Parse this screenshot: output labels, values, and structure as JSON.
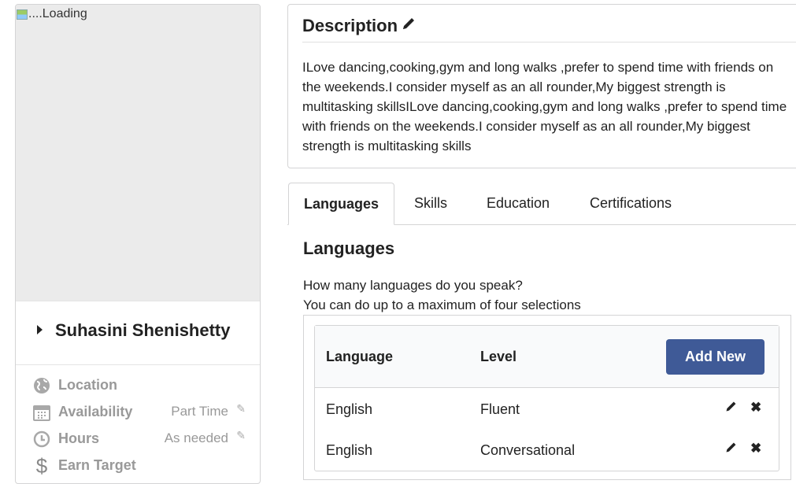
{
  "profile": {
    "photo_alt": "....Loading",
    "name": "Suhasini Shenishetty",
    "info": [
      {
        "icon": "globe-icon",
        "label": "Location",
        "value": ""
      },
      {
        "icon": "calendar-icon",
        "label": "Availability",
        "value": "Part Time"
      },
      {
        "icon": "clock-icon",
        "label": "Hours",
        "value": "As needed"
      },
      {
        "icon": "dollar-icon",
        "label": "Earn Target",
        "value": ""
      }
    ]
  },
  "description": {
    "title": "Description",
    "text": "ILove dancing,cooking,gym and long walks ,prefer to spend time with friends on the weekends.I consider myself as an all rounder,My biggest strength is multitasking skillsILove dancing,cooking,gym and long walks ,prefer to spend time with friends on the weekends.I consider myself as an all rounder,My biggest strength is multitasking skills"
  },
  "tabs": [
    {
      "label": "Languages",
      "active": true
    },
    {
      "label": "Skills",
      "active": false
    },
    {
      "label": "Education",
      "active": false
    },
    {
      "label": "Certifications",
      "active": false
    }
  ],
  "languages": {
    "heading": "Languages",
    "question": "How many languages do you speak?",
    "hint": "You can do up to a maximum of four selections",
    "columns": [
      "Language",
      "Level"
    ],
    "add_label": "Add New",
    "rows": [
      {
        "language": "English",
        "level": "Fluent"
      },
      {
        "language": "English",
        "level": "Conversational"
      }
    ]
  },
  "colors": {
    "accent": "#3f5a97",
    "border": "#d4d4d5",
    "muted": "#999999"
  }
}
